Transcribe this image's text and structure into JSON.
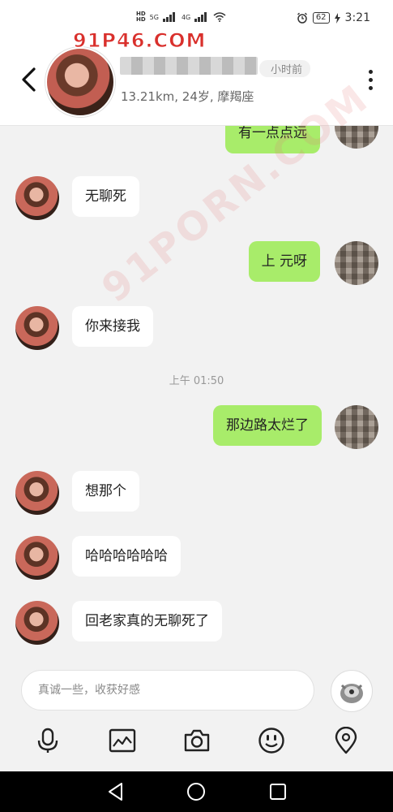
{
  "status_bar": {
    "time": "3:21",
    "battery": "62",
    "network_a": "4G",
    "network_b": "5G"
  },
  "watermark": {
    "top": "91P46.COM",
    "diagonal": "91PORN.COM"
  },
  "header": {
    "contact_name": "",
    "last_seen": "小时前",
    "meta": "13.21km, 24岁, 摩羯座"
  },
  "messages": [
    {
      "side": "out",
      "text": "有一点点远"
    },
    {
      "side": "in",
      "text": "无聊死"
    },
    {
      "side": "out",
      "text": "上        元呀"
    },
    {
      "side": "in",
      "text": "你来接我"
    },
    {
      "side": "time",
      "text": "上午 01:50"
    },
    {
      "side": "out",
      "text": "那边路太烂了"
    },
    {
      "side": "in",
      "text": "想那个"
    },
    {
      "side": "in",
      "text": "哈哈哈哈哈哈"
    },
    {
      "side": "in",
      "text": "回老家真的无聊死了"
    }
  ],
  "input": {
    "placeholder": "真诚一些，收获好感",
    "value": ""
  },
  "toolbar": {
    "icons": [
      "microphone-icon",
      "image-icon",
      "camera-icon",
      "emoji-icon",
      "location-icon"
    ]
  },
  "colors": {
    "outgoing_bubble": "#a8ec6a",
    "incoming_bubble": "#ffffff",
    "background": "#f2f2f2"
  }
}
